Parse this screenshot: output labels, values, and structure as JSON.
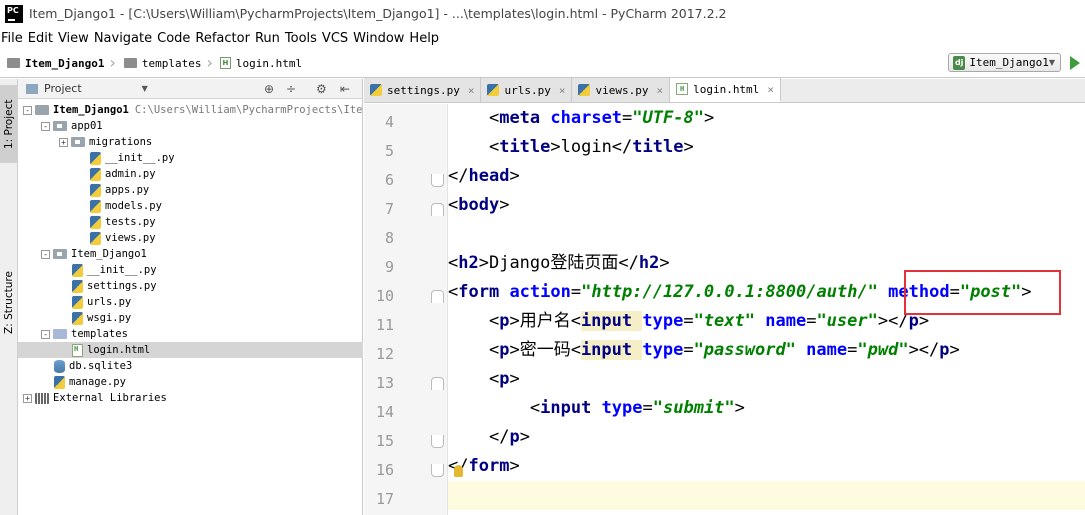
{
  "window": {
    "title": "Item_Django1 - [C:\\Users\\William\\PycharmProjects\\Item_Django1] - ...\\templates\\login.html - PyCharm 2017.2.2",
    "logo_text": "PC"
  },
  "menu": [
    "File",
    "Edit",
    "View",
    "Navigate",
    "Code",
    "Refactor",
    "Run",
    "Tools",
    "VCS",
    "Window",
    "Help"
  ],
  "breadcrumb": [
    "Item_Django1",
    "templates",
    "login.html"
  ],
  "run_config": {
    "icon": "dj",
    "label": "Item_Django1"
  },
  "toolstrip": {
    "project_tab": "1: Project",
    "structure_tab": "Z: Structure"
  },
  "project_panel": {
    "header": "Project",
    "tree": [
      {
        "label": "Item_Django1",
        "hint": "C:\\Users\\William\\PycharmProjects\\Ite",
        "type": "root",
        "expander": "-"
      },
      {
        "label": "app01",
        "type": "pkg",
        "expander": "-"
      },
      {
        "label": "migrations",
        "type": "pkg",
        "expander": "+"
      },
      {
        "label": "__init__.py",
        "type": "py"
      },
      {
        "label": "admin.py",
        "type": "py"
      },
      {
        "label": "apps.py",
        "type": "py"
      },
      {
        "label": "models.py",
        "type": "py"
      },
      {
        "label": "tests.py",
        "type": "py"
      },
      {
        "label": "views.py",
        "type": "py"
      },
      {
        "label": "Item_Django1",
        "type": "pkg",
        "expander": "-"
      },
      {
        "label": "__init__.py",
        "type": "py"
      },
      {
        "label": "settings.py",
        "type": "py"
      },
      {
        "label": "urls.py",
        "type": "py"
      },
      {
        "label": "wsgi.py",
        "type": "py"
      },
      {
        "label": "templates",
        "type": "tpl",
        "expander": "-"
      },
      {
        "label": "login.html",
        "type": "html",
        "selected": true
      },
      {
        "label": "db.sqlite3",
        "type": "db"
      },
      {
        "label": "manage.py",
        "type": "py"
      },
      {
        "label": "External Libraries",
        "type": "lib",
        "expander": "+"
      }
    ]
  },
  "editor": {
    "tabs": [
      {
        "label": "settings.py",
        "icon": "py"
      },
      {
        "label": "urls.py",
        "icon": "py"
      },
      {
        "label": "views.py",
        "icon": "py"
      },
      {
        "label": "login.html",
        "icon": "html",
        "active": true
      }
    ],
    "line_numbers": [
      "4",
      "5",
      "6",
      "7",
      "8",
      "9",
      "10",
      "11",
      "12",
      "13",
      "14",
      "15",
      "16",
      "17"
    ],
    "lines": [
      [
        {
          "c": "p",
          "s": "    "
        },
        {
          "c": "p",
          "s": "<"
        },
        {
          "c": "t",
          "s": "meta "
        },
        {
          "c": "a",
          "s": "charset"
        },
        {
          "c": "p",
          "s": "="
        },
        {
          "c": "v",
          "s": "\"UTF-8\""
        },
        {
          "c": "p",
          "s": ">"
        }
      ],
      [
        {
          "c": "p",
          "s": "    "
        },
        {
          "c": "p",
          "s": "<"
        },
        {
          "c": "t",
          "s": "title"
        },
        {
          "c": "p",
          "s": ">login</"
        },
        {
          "c": "t",
          "s": "title"
        },
        {
          "c": "p",
          "s": ">"
        }
      ],
      [
        {
          "c": "p",
          "s": "</"
        },
        {
          "c": "t",
          "s": "head"
        },
        {
          "c": "p",
          "s": ">"
        }
      ],
      [
        {
          "c": "p",
          "s": "<"
        },
        {
          "c": "t",
          "s": "body"
        },
        {
          "c": "p",
          "s": ">"
        }
      ],
      [],
      [
        {
          "c": "p",
          "s": "<"
        },
        {
          "c": "t",
          "s": "h2"
        },
        {
          "c": "p",
          "s": ">Django登陆页面</"
        },
        {
          "c": "t",
          "s": "h2"
        },
        {
          "c": "p",
          "s": ">"
        }
      ],
      [
        {
          "c": "p",
          "s": "<"
        },
        {
          "c": "t",
          "s": "form "
        },
        {
          "c": "a",
          "s": "action"
        },
        {
          "c": "p",
          "s": "="
        },
        {
          "c": "v",
          "s": "\"http://127.0.0.1:8800/auth/\""
        },
        {
          "c": "p",
          "s": " "
        },
        {
          "c": "a",
          "s": "method"
        },
        {
          "c": "p",
          "s": "="
        },
        {
          "c": "v",
          "s": "\"post\""
        },
        {
          "c": "p",
          "s": ">"
        }
      ],
      [
        {
          "c": "p",
          "s": "    "
        },
        {
          "c": "p",
          "s": "<"
        },
        {
          "c": "t",
          "s": "p"
        },
        {
          "c": "p",
          "s": ">用户名<"
        },
        {
          "c": "th",
          "s": "input "
        },
        {
          "c": "a",
          "s": "type"
        },
        {
          "c": "p",
          "s": "="
        },
        {
          "c": "v",
          "s": "\"text\""
        },
        {
          "c": "p",
          "s": " "
        },
        {
          "c": "a",
          "s": "name"
        },
        {
          "c": "p",
          "s": "="
        },
        {
          "c": "v",
          "s": "\"user\""
        },
        {
          "c": "p",
          "s": "></"
        },
        {
          "c": "t",
          "s": "p"
        },
        {
          "c": "p",
          "s": ">"
        }
      ],
      [
        {
          "c": "p",
          "s": "    "
        },
        {
          "c": "p",
          "s": "<"
        },
        {
          "c": "t",
          "s": "p"
        },
        {
          "c": "p",
          "s": ">密一码<"
        },
        {
          "c": "th",
          "s": "input "
        },
        {
          "c": "a",
          "s": "type"
        },
        {
          "c": "p",
          "s": "="
        },
        {
          "c": "v",
          "s": "\"password\""
        },
        {
          "c": "p",
          "s": " "
        },
        {
          "c": "a",
          "s": "name"
        },
        {
          "c": "p",
          "s": "="
        },
        {
          "c": "v",
          "s": "\"pwd\""
        },
        {
          "c": "p",
          "s": "></"
        },
        {
          "c": "t",
          "s": "p"
        },
        {
          "c": "p",
          "s": ">"
        }
      ],
      [
        {
          "c": "p",
          "s": "    "
        },
        {
          "c": "p",
          "s": "<"
        },
        {
          "c": "t",
          "s": "p"
        },
        {
          "c": "p",
          "s": ">"
        }
      ],
      [
        {
          "c": "p",
          "s": "        "
        },
        {
          "c": "p",
          "s": "<"
        },
        {
          "c": "t",
          "s": "input "
        },
        {
          "c": "a",
          "s": "type"
        },
        {
          "c": "p",
          "s": "="
        },
        {
          "c": "v",
          "s": "\"submit\""
        },
        {
          "c": "p",
          "s": ">"
        }
      ],
      [
        {
          "c": "p",
          "s": "    "
        },
        {
          "c": "p",
          "s": "</"
        },
        {
          "c": "t",
          "s": "p"
        },
        {
          "c": "p",
          "s": ">"
        }
      ],
      [
        {
          "c": "p",
          "s": "</"
        },
        {
          "c": "t",
          "s": "form"
        },
        {
          "c": "p",
          "s": ">"
        }
      ],
      []
    ],
    "current_line": "17",
    "highlight_color": "#e2313b"
  }
}
